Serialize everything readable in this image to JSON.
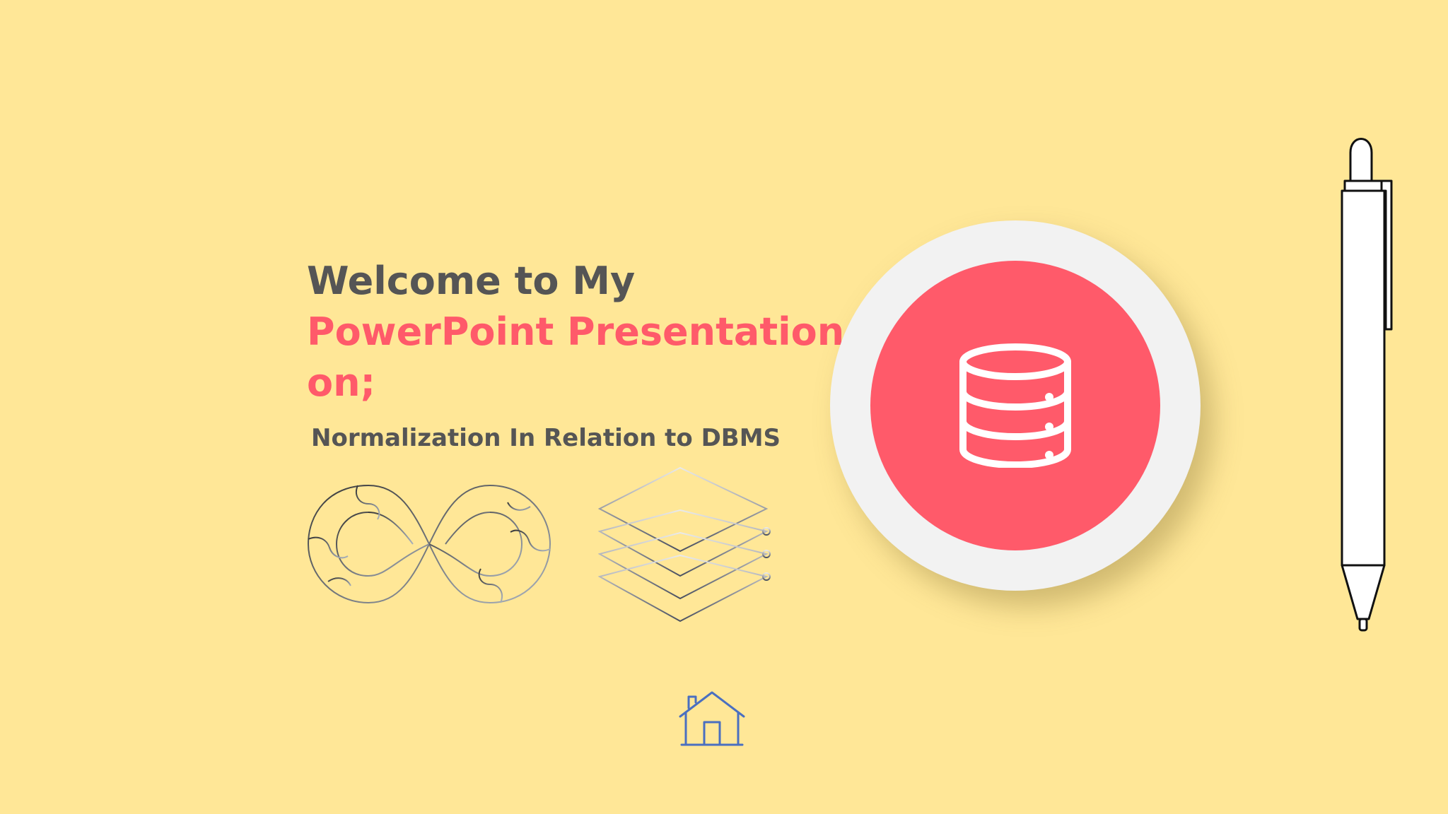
{
  "slide": {
    "title_line_1": "Welcome to My",
    "title_line_2": "PowerPoint Presentation",
    "title_line_3": "on;",
    "subtitle": "Normalization In Relation to DBMS"
  },
  "icons": {
    "infinity": "infinity-icon",
    "layers": "layers-icon",
    "database": "database-icon",
    "pen": "pen-icon",
    "home": "home-icon"
  },
  "colors": {
    "background": "#FFE797",
    "accent": "#FF5A6A",
    "text_dark": "#555555",
    "badge_ring": "#F2F2F2",
    "home_icon": "#4A6FC0"
  }
}
